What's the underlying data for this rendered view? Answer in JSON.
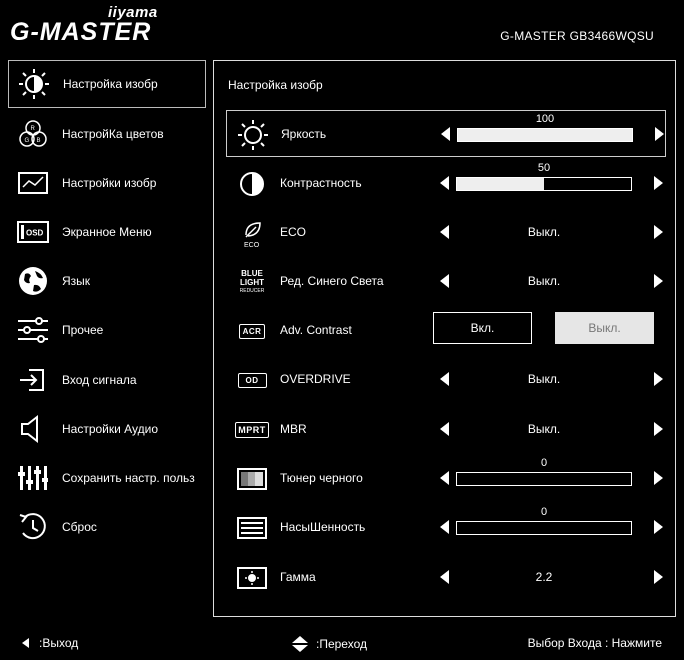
{
  "brand": {
    "company": "iiyama",
    "series": "G-MASTER"
  },
  "model": "G-MASTER   GB3466WQSU",
  "sidebar": {
    "items": [
      {
        "label": "Настройка изобр",
        "icon": "brightness-icon",
        "active": true
      },
      {
        "label": "НастройКа цветов",
        "icon": "rgb-color-icon"
      },
      {
        "label": "Настройки изобр",
        "icon": "image-settings-icon"
      },
      {
        "label": "Экранное Меню",
        "icon": "osd-icon"
      },
      {
        "label": "Язык",
        "icon": "globe-icon"
      },
      {
        "label": "Прочее",
        "icon": "sliders-icon"
      },
      {
        "label": "Вход сигнала",
        "icon": "input-signal-icon"
      },
      {
        "label": "Настройки Аудио",
        "icon": "speaker-icon"
      },
      {
        "label": "Сохранить настр. польз",
        "icon": "equalizer-icon"
      },
      {
        "label": "Сброс",
        "icon": "reset-clock-icon"
      }
    ]
  },
  "panel": {
    "title": "Настройка изобр",
    "rows": [
      {
        "label": "Яркость",
        "type": "slider",
        "value": "100",
        "level": 1.0,
        "icon": "brightness-icon"
      },
      {
        "label": "Контрастность",
        "type": "slider",
        "value": "50",
        "level": 0.5,
        "icon": "contrast-icon"
      },
      {
        "label": "ECO",
        "type": "select",
        "value": "Выкл.",
        "icon": "eco-leaf-icon",
        "icon_text": "ECO"
      },
      {
        "label": "Ред. Синего Света",
        "type": "select",
        "value": "Выкл.",
        "icon": "blue-light-reducer-icon",
        "icon_text": "BLUE LIGHT REDUCER"
      },
      {
        "label": "Adv. Contrast",
        "type": "toggle",
        "on_label": "Вкл.",
        "off_label": "Выкл.",
        "icon": "acr-icon",
        "icon_text": "ACR"
      },
      {
        "label": "OVERDRIVE",
        "type": "select",
        "value": "Выкл.",
        "icon": "od-icon",
        "icon_text": "OD"
      },
      {
        "label": "MBR",
        "type": "select",
        "value": "Выкл.",
        "icon": "mprt-icon",
        "icon_text": "MPRT"
      },
      {
        "label": "Тюнер черного",
        "type": "slider",
        "value": "0",
        "level": 0.0,
        "icon": "black-tuner-icon"
      },
      {
        "label": "НасыШенность",
        "type": "slider",
        "value": "0",
        "level": 0.0,
        "icon": "saturation-icon"
      },
      {
        "label": "Гамма",
        "type": "select",
        "value": "2.2",
        "icon": "gamma-icon"
      }
    ]
  },
  "footer": {
    "exit": ":Выход",
    "navigate": ":Переход",
    "input_select": "Выбор Входа : Нажмите"
  }
}
